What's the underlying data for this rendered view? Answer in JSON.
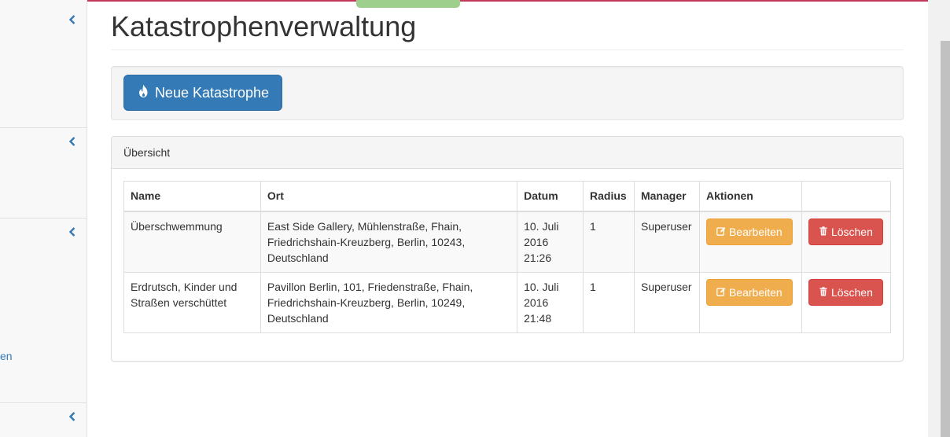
{
  "page": {
    "title": "Katastrophenverwaltung"
  },
  "actions": {
    "new_label": "Neue Katastrophe"
  },
  "sidebar": {
    "partial_text": "en"
  },
  "overview": {
    "heading": "Übersicht",
    "columns": [
      "Name",
      "Ort",
      "Datum",
      "Radius",
      "Manager",
      "Aktionen",
      ""
    ],
    "rows": [
      {
        "name": "Überschwemmung",
        "ort": "East Side Gallery, Mühlenstraße, Fhain, Friedrichshain-Kreuzberg, Berlin, 10243, Deutschland",
        "datum": "10. Juli 2016 21:26",
        "radius": "1",
        "manager": "Superuser",
        "edit_label": "Bearbeiten",
        "delete_label": "Löschen"
      },
      {
        "name": "Erdrutsch, Kinder und Straßen verschüttet",
        "ort": "Pavillon Berlin, 101, Friedenstraße, Fhain, Friedrichshain-Kreuzberg, Berlin, 10249, Deutschland",
        "datum": "10. Juli 2016 21:48",
        "radius": "1",
        "manager": "Superuser",
        "edit_label": "Bearbeiten",
        "delete_label": "Löschen"
      }
    ]
  },
  "colors": {
    "primary": "#337ab7",
    "warning": "#f0ad4e",
    "danger": "#d9534f",
    "accent_top": "#c0395a",
    "tab_green": "#9fcf8c"
  },
  "icons": {
    "new": "fire-icon",
    "edit": "edit-icon",
    "delete": "trash-icon",
    "sidebar": "chevron-left-icon"
  }
}
